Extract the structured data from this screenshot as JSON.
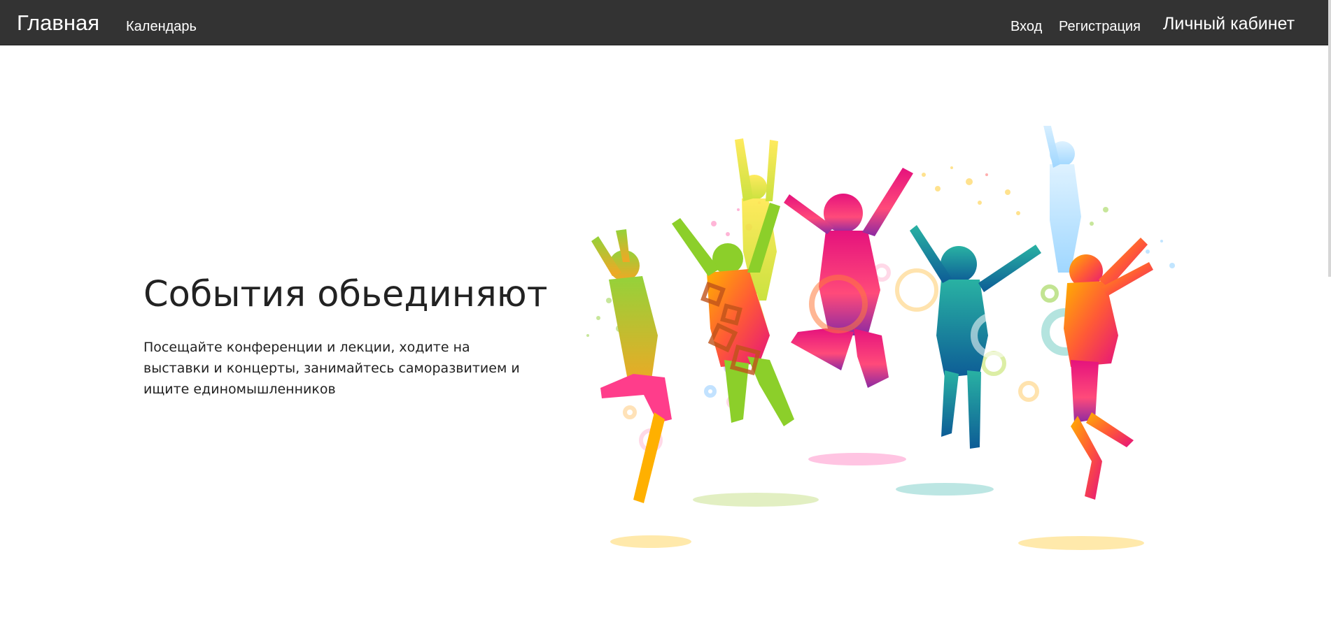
{
  "navbar": {
    "brand": "Главная",
    "links": {
      "calendar": "Календарь",
      "login": "Вход",
      "register": "Регистрация",
      "account": "Личный кабинет"
    },
    "background_color": "#333333"
  },
  "hero": {
    "title": "События обьединяют",
    "description": "Посещайте конференции и лекции, ходите на выставки и концерты, занимайтесь саморазвитием и ищите единомышленников",
    "illustration": "jumping-people-silhouettes-illustration",
    "palette": [
      "#ff5a36",
      "#e5127d",
      "#f7d51f",
      "#8ccf2a",
      "#0c8f7a",
      "#5fb3ea"
    ]
  }
}
